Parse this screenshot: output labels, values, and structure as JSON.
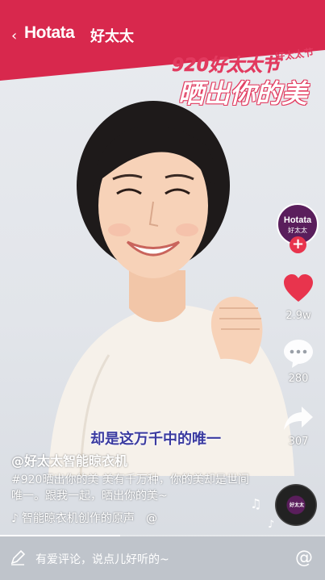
{
  "brand": {
    "logo": "Hotata",
    "name_cn": "好太太"
  },
  "campaign": {
    "line1": "920好太太节",
    "line2": "晒出你的美",
    "tag": "好太太节"
  },
  "subtitle": "却是这万千中的唯一",
  "rail": {
    "avatar_logo": "Hotata",
    "avatar_cn": "好太太",
    "likes": "2.9w",
    "comments": "280",
    "shares": "307"
  },
  "post": {
    "author": "@好太太智能晾衣机",
    "description": "#920晒出你的美 美有千万种，你的美却是世间唯一。跟我一起，晒出你的美~",
    "music": "智能晾衣机创作的原声",
    "music_at": "@"
  },
  "disc": {
    "label": "好太太"
  },
  "progress": {
    "fraction": 0.37
  },
  "comment_bar": {
    "placeholder": "有爱评论，说点儿好听的~",
    "at": "@"
  },
  "colors": {
    "brand_red": "#d8284d",
    "like_red": "#e8344d",
    "avatar_purple": "#5a1e5c"
  }
}
